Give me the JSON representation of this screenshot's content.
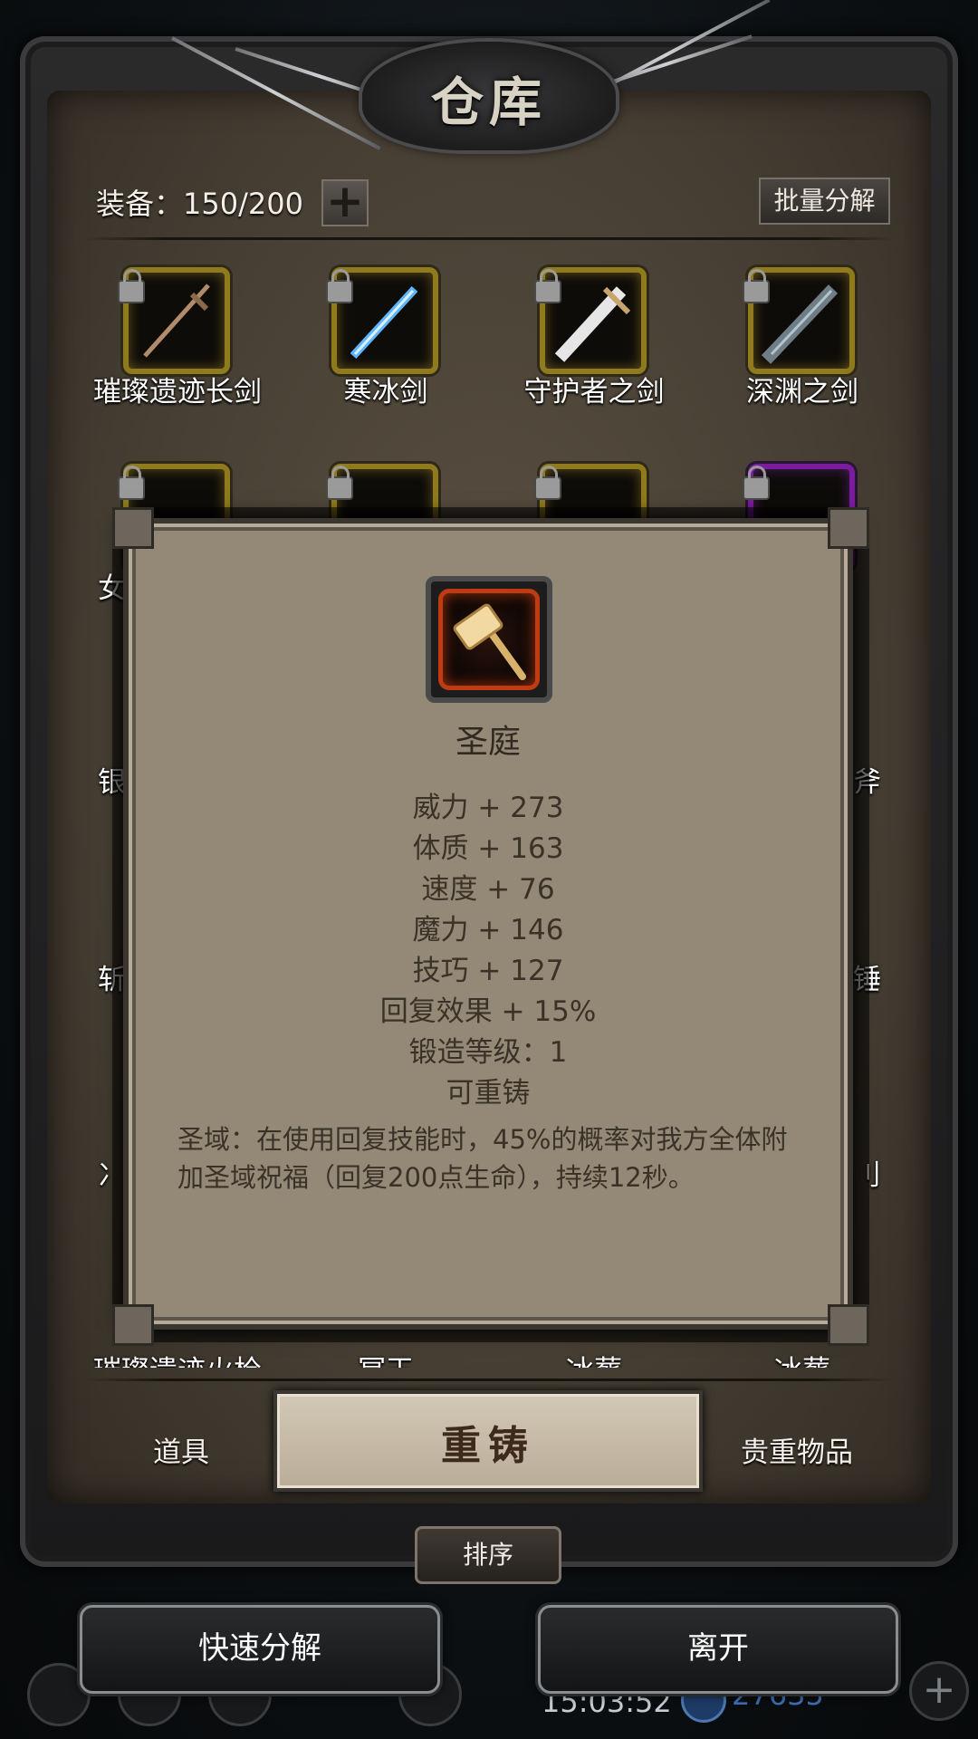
{
  "window": {
    "title": "仓库"
  },
  "inventory": {
    "capacity_text": "装备：150/200",
    "add_label": "+",
    "batch_decompose_label": "批量分解",
    "row1": [
      {
        "name": "璀璨遗迹长剑",
        "rarity": "gold"
      },
      {
        "name": "寒冰剑",
        "rarity": "gold"
      },
      {
        "name": "守护者之剑",
        "rarity": "gold"
      },
      {
        "name": "深渊之剑",
        "rarity": "gold"
      }
    ],
    "row2_rarity": [
      "gold",
      "gold",
      "gold",
      "purple"
    ],
    "partial_left_names": [
      "女",
      "银",
      "斩",
      "冫"
    ],
    "partial_right_names": [
      "斧",
      "锤",
      "刂"
    ],
    "bottom_row_names": [
      "璀璨遗迹火枪",
      "冥王",
      "冰葬",
      "冰葬"
    ]
  },
  "tabs": {
    "left_label": "道具",
    "center_label": "重铸",
    "right_label": "贵重物品"
  },
  "sort_label": "排序",
  "actions": {
    "quick_decompose": "快速分解",
    "leave": "离开"
  },
  "hud": {
    "time": "15:03:52",
    "gems": "27635"
  },
  "detail": {
    "name": "圣庭",
    "icon": "golden-hammer-icon",
    "stats": [
      "威力 + 273",
      "体质 + 163",
      "速度 + 76",
      "魔力 + 146",
      "技巧 + 127",
      "回复效果 + 15%",
      "锻造等级：1",
      "可重铸"
    ],
    "skill_description": "圣域：在使用回复技能时，45%的概率对我方全体附加圣域祝福（回复200点生命），持续12秒。"
  },
  "colors": {
    "gold_rarity": "#8f7a1d",
    "purple_rarity": "#7a1d9c",
    "popup_bg": "#948877",
    "panel_bg": "#463e33"
  }
}
